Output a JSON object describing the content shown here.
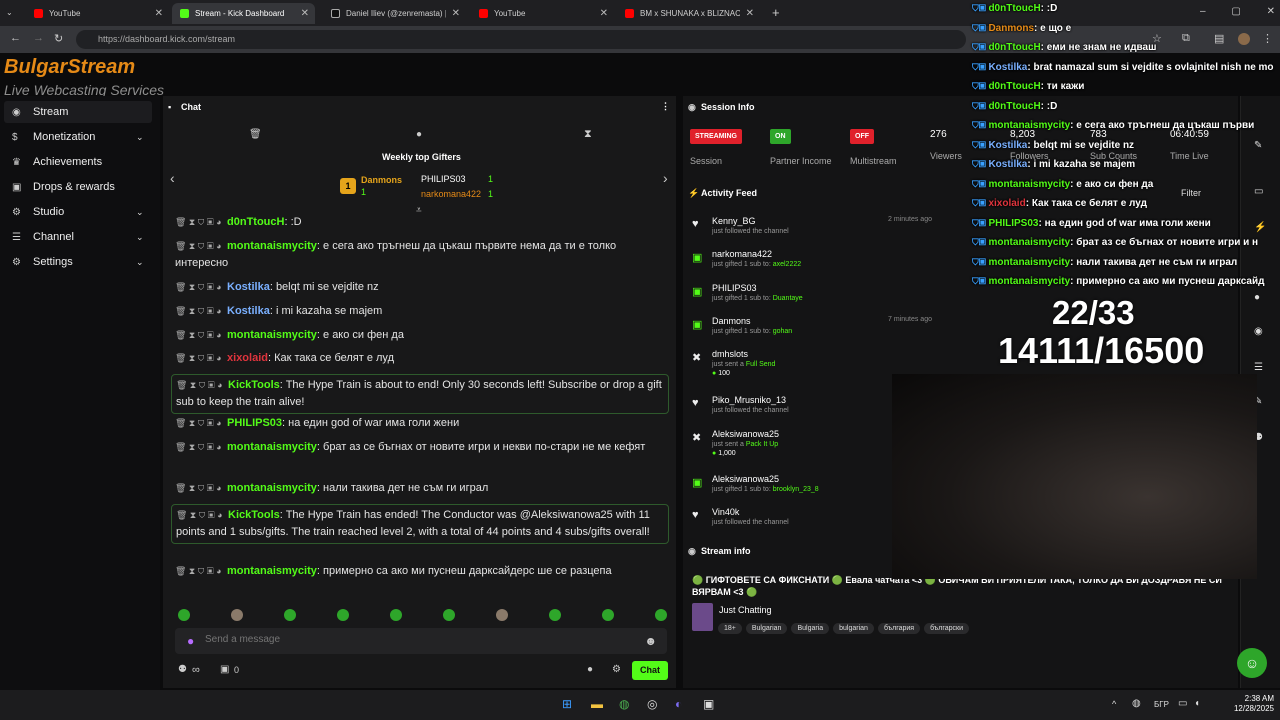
{
  "browser": {
    "tabs": [
      {
        "label": "YouTube",
        "active": false
      },
      {
        "label": "Stream - Kick Dashboard",
        "active": true
      },
      {
        "label": "Daniel Iliev (@zenremasta) | Tik",
        "active": false
      },
      {
        "label": "YouTube",
        "active": false
      },
      {
        "label": "BM x SHUNAKA x BLIZNACITE",
        "active": false
      }
    ],
    "url": "https://dashboard.kick.com/stream"
  },
  "site": {
    "logo_top": "BulgarStream",
    "logo_sub": "Live Webcasting Services"
  },
  "sidebar": {
    "items": [
      {
        "label": "Stream",
        "icon": "broadcast-icon",
        "has_chevron": false,
        "active": true
      },
      {
        "label": "Monetization",
        "icon": "dollar-icon",
        "has_chevron": true
      },
      {
        "label": "Achievements",
        "icon": "trophy-icon",
        "has_chevron": false
      },
      {
        "label": "Drops & rewards",
        "icon": "gift-icon",
        "has_chevron": false
      },
      {
        "label": "Studio",
        "icon": "gear-icon",
        "has_chevron": true
      },
      {
        "label": "Channel",
        "icon": "user-icon",
        "has_chevron": true
      },
      {
        "label": "Settings",
        "icon": "settings-icon",
        "has_chevron": true
      }
    ]
  },
  "chat": {
    "title": "Chat",
    "weekly_title": "Weekly top Gifters",
    "gifters": [
      {
        "rank": "1",
        "name": "Danmons",
        "count": "1"
      },
      {
        "name": "PHILIPS03",
        "count": "1"
      },
      {
        "name": "narkomana422",
        "count": "1"
      }
    ],
    "messages": [
      {
        "user": "d0nTtoucH",
        "color": "#53fc18",
        "text": ":D",
        "boxed": false
      },
      {
        "user": "montanaismycity",
        "color": "#53fc18",
        "text": "е сега ако тръгнеш да цъкаш първите нема да ти е толко интересно",
        "boxed": false
      },
      {
        "user": "Kostilka",
        "color": "#7ab0ff",
        "text": "belqt mi se vejdite nz",
        "boxed": false
      },
      {
        "user": "Kostilka",
        "color": "#7ab0ff",
        "text": "i mi kazaha se majem",
        "boxed": false
      },
      {
        "user": "montanaismycity",
        "color": "#53fc18",
        "text": "е ако си фен да",
        "boxed": false
      },
      {
        "user": "xixolaid",
        "color": "#e0343d",
        "text": "Как така се белят е луд",
        "boxed": false
      },
      {
        "user": "KickTools",
        "color": "#53fc18",
        "text": "The Hype Train is about to end! Only 30 seconds left! Subscribe or drop a gift sub to keep the train alive!",
        "boxed": true
      },
      {
        "user": "PHILIPS03",
        "color": "#53fc18",
        "text": "на един god of war има голи жени",
        "boxed": false
      },
      {
        "user": "montanaismycity",
        "color": "#53fc18",
        "text": "брат аз се бъгнах от новите игри и некви по-стари не ме кефят",
        "boxed": false
      },
      {
        "user": "montanaismycity",
        "color": "#53fc18",
        "text": "нали такива дет не съм ги играл",
        "boxed": false
      },
      {
        "user": "KickTools",
        "color": "#53fc18",
        "text": "The Hype Train has ended! The Conductor was @Aleksiwanowa25 with 11 points and 1 subs/gifts. The train reached level 2, with a total of 44 points and 4 subs/gifts overall!",
        "boxed": true
      },
      {
        "user": "montanaismycity",
        "color": "#53fc18",
        "text": "примерно са ако ми пуснеш дарксайдерс ше се разцепа",
        "boxed": false
      }
    ],
    "send_placeholder": "Send a message",
    "viewer_count_icon": "∞",
    "pinned_count": "0",
    "chat_button": "Chat"
  },
  "session": {
    "title": "Session Info",
    "badges": [
      {
        "value": "STREAMING",
        "label": "Session",
        "color": "#e0212b"
      },
      {
        "value": "ON",
        "label": "Partner Income",
        "color": "#2ea62a"
      },
      {
        "value": "OFF",
        "label": "Multistream",
        "color": "#e0212b"
      }
    ],
    "stats": [
      {
        "value": "276",
        "label": "Viewers"
      },
      {
        "value": "8,203",
        "label": "Followers"
      },
      {
        "value": "783",
        "label": "Sub Counts"
      },
      {
        "value": "06:40:59",
        "label": "Time Live"
      }
    ],
    "activity_title": "Activity Feed",
    "filter": "Filter",
    "activity": [
      {
        "icon": "heart-icon",
        "name": "Kenny_BG",
        "detail": "just followed the channel",
        "extra": "",
        "time": "2 minutes ago"
      },
      {
        "icon": "gift-icon",
        "name": "narkomana422",
        "detail": "just gifted 1 sub to:",
        "extra": "axel2222",
        "time": ""
      },
      {
        "icon": "gift-icon",
        "name": "PHILIPS03",
        "detail": "just gifted 1 sub to:",
        "extra": "Duantaye",
        "time": ""
      },
      {
        "icon": "gift-icon",
        "name": "Danmons",
        "detail": "just gifted 1 sub to:",
        "extra": "gohan",
        "time": "7 minutes ago"
      },
      {
        "icon": "kick-icon",
        "name": "dmhslots",
        "detail": "just sent a",
        "extra": "Full Send",
        "amount": "100",
        "time": ""
      },
      {
        "icon": "heart-icon",
        "name": "Piko_Mrusniko_13",
        "detail": "just followed the channel",
        "extra": "",
        "time": ""
      },
      {
        "icon": "kick-icon",
        "name": "Aleksiwanowa25",
        "detail": "just sent a",
        "extra": "Pack It Up",
        "amount": "1,000",
        "time": ""
      },
      {
        "icon": "gift-icon",
        "name": "Aleksiwanowa25",
        "detail": "just gifted 1 sub to:",
        "extra": "brooklyn_23_8",
        "time": ""
      },
      {
        "icon": "heart-icon",
        "name": "Vin40k",
        "detail": "just followed the channel",
        "extra": "",
        "time": ""
      }
    ],
    "stream_info_title": "Stream info",
    "stream_title": "🟢 ГИФТОВЕТЕ СА ФИКСНАТИ 🟢 Евала чатчата <3 🟢 ОБИЧАМ ВИ ПРИЯТЕЛИ ТАКА, ТОЛКО ДА ВИ ДОЗДРАВЯ НЕ СИ ВЯРВАМ <3 🟢",
    "category": "Just Chatting",
    "tags": [
      "18+",
      "Bulgarian",
      "Bulgaria",
      "bulgarian",
      "българия",
      "български"
    ]
  },
  "overlay": {
    "chat": [
      {
        "user": "d0nTtoucH",
        "color": "#53fc18",
        "text": ":D"
      },
      {
        "user": "Danmons",
        "color": "#e58a17",
        "text": "е що е"
      },
      {
        "user": "d0nTtoucH",
        "color": "#53fc18",
        "text": "еми не знам не идваш"
      },
      {
        "user": "Kostilka",
        "color": "#7ab0ff",
        "text": "brat namazal sum si vejdite s ovlajnitel nish ne mo"
      },
      {
        "user": "d0nTtoucH",
        "color": "#53fc18",
        "text": "ти кажи"
      },
      {
        "user": "d0nTtoucH",
        "color": "#53fc18",
        "text": ":D"
      },
      {
        "user": "montanaismycity",
        "color": "#53fc18",
        "text": "е сега ако тръгнеш да цъкаш първи"
      },
      {
        "user": "Kostilka",
        "color": "#7ab0ff",
        "text": "belqt mi se vejdite nz"
      },
      {
        "user": "Kostilka",
        "color": "#7ab0ff",
        "text": "i mi kazaha se majem"
      },
      {
        "user": "montanaismycity",
        "color": "#53fc18",
        "text": "е ако си фен да"
      },
      {
        "user": "xixolaid",
        "color": "#e0343d",
        "text": "Как така се белят е луд"
      },
      {
        "user": "PHILIPS03",
        "color": "#53fc18",
        "text": "на един god of war има голи жени"
      },
      {
        "user": "montanaismycity",
        "color": "#53fc18",
        "text": "брат аз се бъгнах от новите игри и н"
      },
      {
        "user": "montanaismycity",
        "color": "#53fc18",
        "text": "нали такива дет не съм ги играл"
      },
      {
        "user": "montanaismycity",
        "color": "#53fc18",
        "text": "примерно са ако ми пуснеш дарксайд"
      }
    ],
    "stat_top": "22/33",
    "stat_bottom": "14111/16500"
  },
  "taskbar": {
    "lang": "БГР",
    "time": "2:38 AM",
    "date": "12/28/2025"
  },
  "colors": {
    "accent": "#53fc18",
    "bg": "#0b0b0c",
    "panel": "#181819"
  }
}
